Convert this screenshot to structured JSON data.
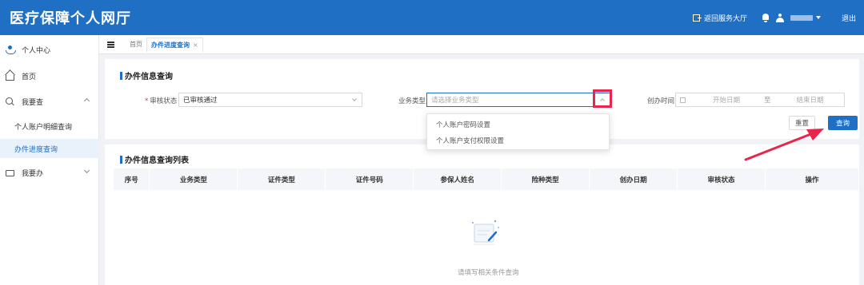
{
  "header": {
    "title": "医疗保障个人网厅",
    "back_label": "返回服务大厅",
    "logout_label": "退出"
  },
  "sidebar": {
    "items": [
      {
        "label": "个人中心",
        "icon": "person-icon"
      },
      {
        "label": "首页",
        "icon": "home-icon"
      },
      {
        "label": "我要查",
        "icon": "search-icon",
        "expanded": true
      },
      {
        "label": "个人账户明细查询"
      },
      {
        "label": "办件进度查询",
        "active": true
      },
      {
        "label": "我要办",
        "icon": "folder-icon",
        "expanded": false
      }
    ]
  },
  "tabs": {
    "home": "首页",
    "current": "办件进度查询",
    "close": "×"
  },
  "search_panel": {
    "title": "办件信息查询",
    "audit_status_label": "审核状态",
    "audit_status_value": "已审核通过",
    "business_type_label": "业务类型",
    "business_type_placeholder": "请选择业务类型",
    "create_time_label": "创办时间",
    "start_date_placeholder": "开始日期",
    "date_separator": "至",
    "end_date_placeholder": "结束日期",
    "reset_label": "重置",
    "query_label": "查询",
    "dropdown_options": [
      "个人账户密码设置",
      "个人账户支付权限设置"
    ]
  },
  "result_panel": {
    "title": "办件信息查询列表",
    "columns": [
      "序号",
      "业务类型",
      "证件类型",
      "证件号码",
      "参保人姓名",
      "险种类型",
      "创办日期",
      "审核状态",
      "操作"
    ],
    "empty_text": "请填写相关条件查询"
  },
  "colors": {
    "brand": "#1f6fc4",
    "highlight": "#e8254a"
  }
}
